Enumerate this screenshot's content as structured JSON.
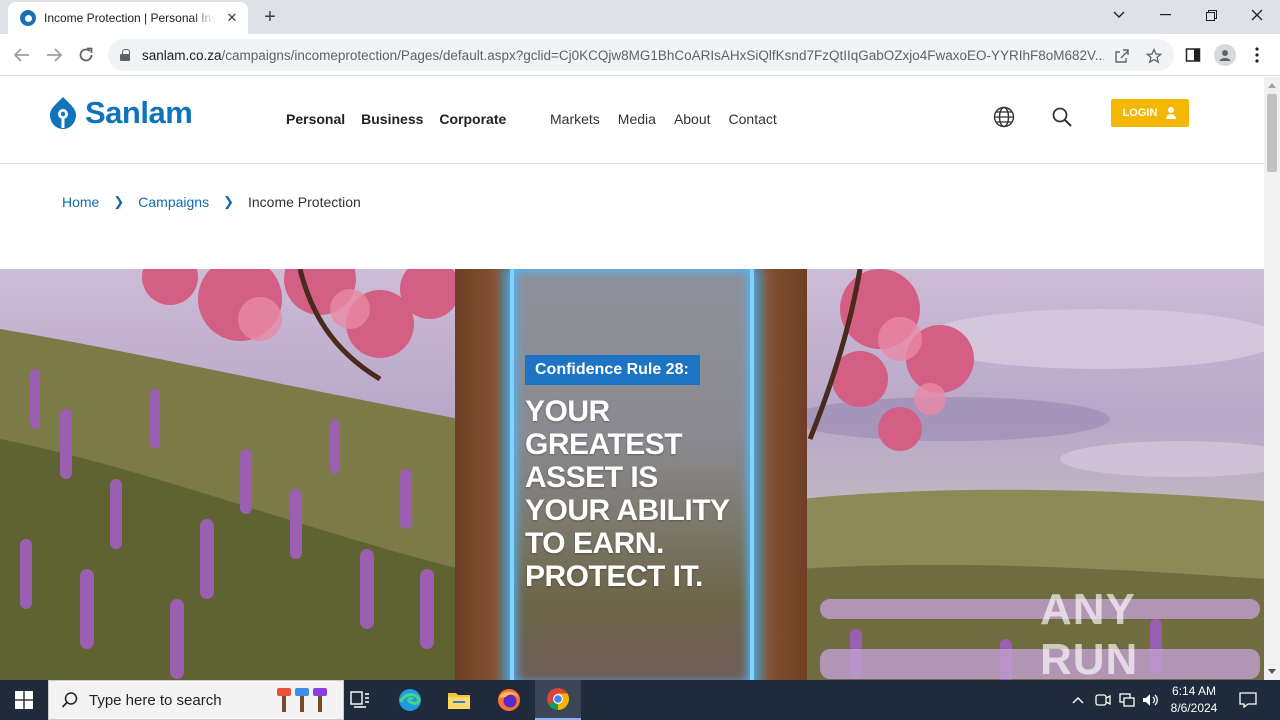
{
  "browser": {
    "tab_title": "Income Protection | Personal Insurance",
    "url_host": "sanlam.co.za",
    "url_path": "/campaigns/incomeprotection/Pages/default.aspx?gclid=Cj0KCQjw8MG1BhCoARIsAHxSiQlfKsnd7FzQtIIqGabOZxjo4FwaxoEO-YYRIhF8oM682V..."
  },
  "site": {
    "logo": "Sanlam",
    "main_nav": [
      "Personal",
      "Business",
      "Corporate"
    ],
    "sub_nav": [
      "Markets",
      "Media",
      "About",
      "Contact"
    ],
    "login_label": "LOGIN",
    "brand_color": "#0f74bc",
    "accent_color": "#f5b800"
  },
  "breadcrumb": {
    "home": "Home",
    "campaigns": "Campaigns",
    "current": "Income Protection"
  },
  "hero": {
    "tag": "Confidence Rule 28:",
    "headline": [
      "YOUR",
      "GREATEST",
      "ASSET IS",
      "YOUR ABILITY",
      "TO EARN.",
      "PROTECT IT."
    ],
    "watermark": "ANY RUN"
  },
  "taskbar": {
    "search_placeholder": "Type here to search",
    "time": "6:14 AM",
    "date": "8/6/2024"
  }
}
